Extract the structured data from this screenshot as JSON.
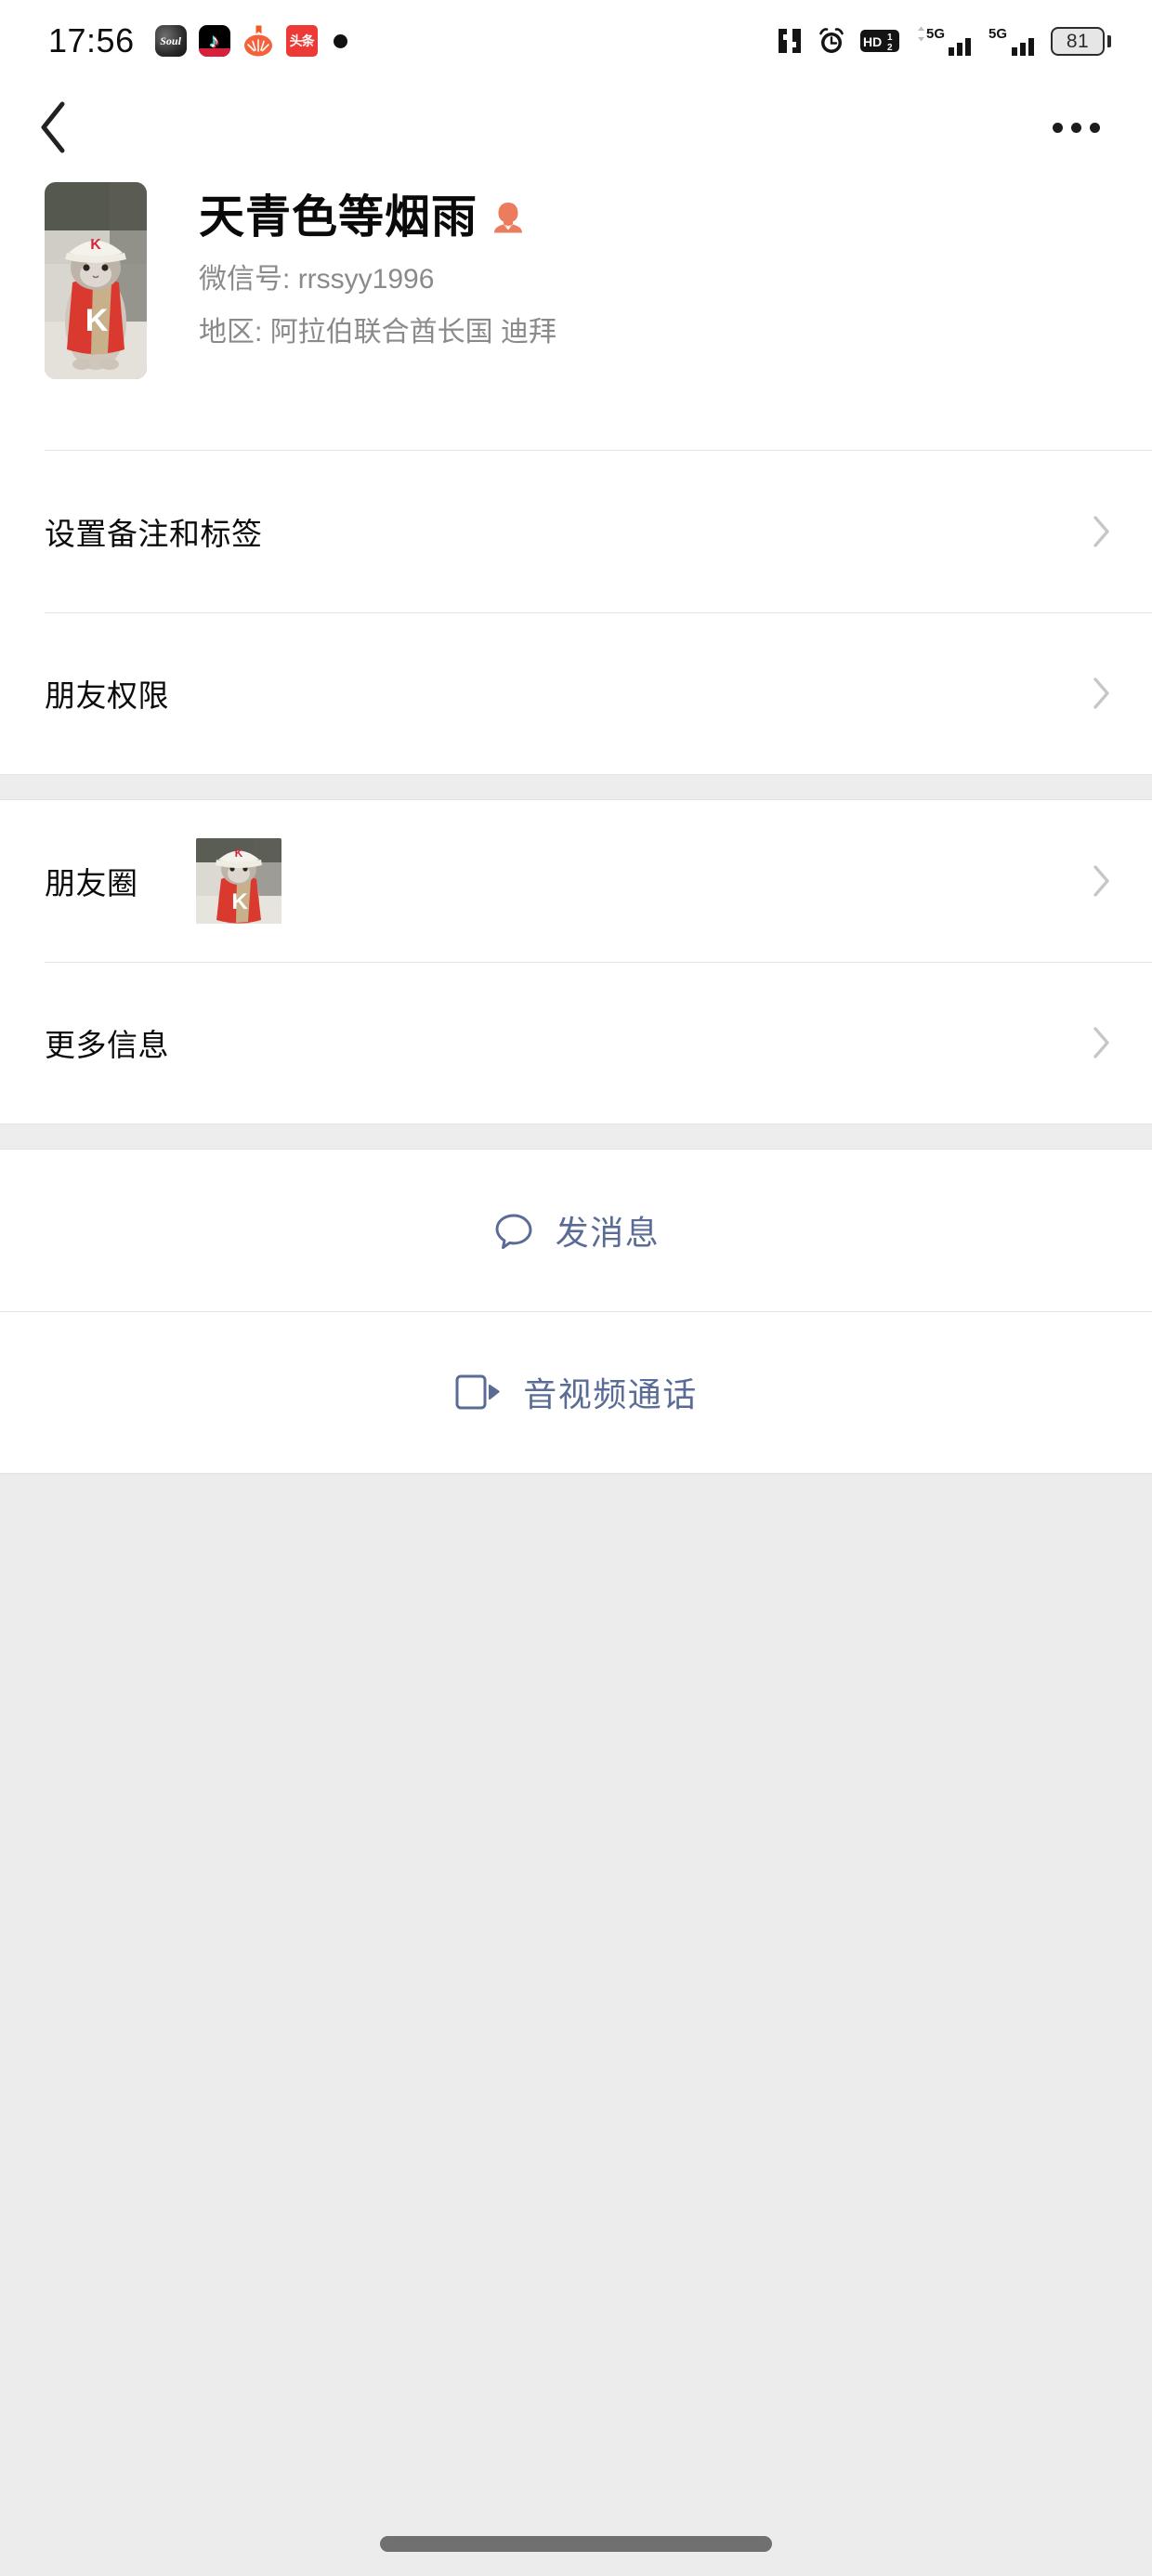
{
  "status_bar": {
    "time": "17:56",
    "notification_icons": [
      {
        "name": "soul-app-icon",
        "label": "Soul"
      },
      {
        "name": "douyin-app-icon",
        "label": "♪"
      },
      {
        "name": "tomato-app-icon",
        "label": ""
      },
      {
        "name": "toutiao-app-icon",
        "label": "头条"
      },
      {
        "name": "notification-dot",
        "label": ""
      }
    ],
    "nfc_icon": "nfc-icon",
    "alarm_icon": "alarm-clock-icon",
    "volte_label": "HD",
    "volte_sup": "1",
    "volte_sub": "2",
    "sim1_network": "5G",
    "sim2_network": "5G",
    "battery_percent": "81"
  },
  "nav": {
    "back_icon": "back-chevron-icon",
    "more_icon": "more-options-icon"
  },
  "profile": {
    "name": "天青色等烟雨",
    "gender_icon": "female-gender-icon",
    "gender_color": "#EC7C5E",
    "wechat_id_label": "微信号:",
    "wechat_id_value": "rrssyy1996",
    "region_label": "地区:",
    "region_value": "阿拉伯联合酋长国  迪拜",
    "avatar_alt": "cat-avatar"
  },
  "sections": [
    {
      "rows": [
        {
          "name": "row-set-remark-and-tags",
          "label": "设置备注和标签",
          "thumb": false
        },
        {
          "name": "row-friend-permissions",
          "label": "朋友权限",
          "thumb": false
        }
      ]
    },
    {
      "rows": [
        {
          "name": "row-moments",
          "label": "朋友圈",
          "thumb": true
        },
        {
          "name": "row-more-info",
          "label": "更多信息",
          "thumb": false
        }
      ]
    }
  ],
  "actions": [
    {
      "name": "send-message-button",
      "label": "发消息",
      "icon": "chat-bubble-icon"
    },
    {
      "name": "video-call-button",
      "label": "音视频通话",
      "icon": "video-camera-icon"
    }
  ],
  "colors": {
    "accent_link": "#5A6C95",
    "gender_orange": "#EC7C5E",
    "divider": "#E4E4E4",
    "section_gap": "#EDEDED",
    "page_filler": "#ECECEC",
    "text_primary": "#0B0B0B",
    "text_secondary": "#8A8A8A"
  }
}
